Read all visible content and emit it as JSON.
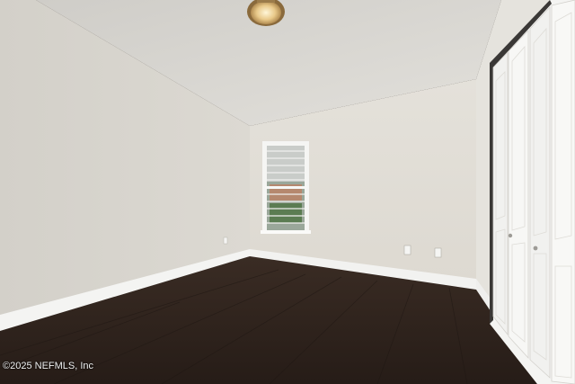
{
  "photo": {
    "subject": "empty bedroom with vaulted textured ceiling, dark wood floor, window and white bifold closet doors",
    "watermark_text": "©2025 NEFMLS, Inc"
  },
  "colors": {
    "left_wall": "#d9d6cf",
    "back_wall": "#e2dfd8",
    "right_wall": "#e6e4de",
    "ceiling": "#dcdad5",
    "floor": "#2f241e",
    "baseboard": "#f6f6f4",
    "closet_door": "#f7f7f5"
  },
  "icons": [
    "ceiling-light-icon",
    "window-blinds-icon",
    "outlet-icon"
  ]
}
